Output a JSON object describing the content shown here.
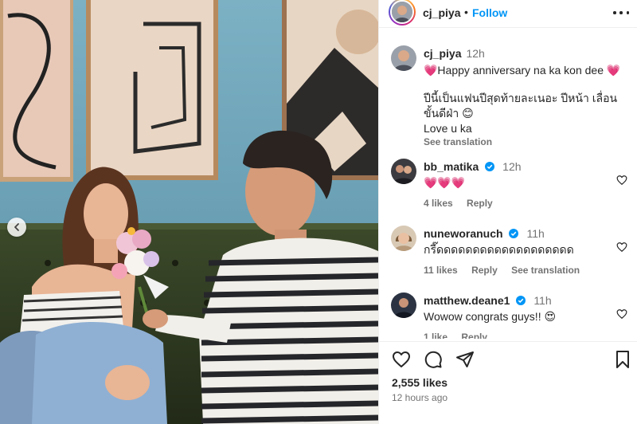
{
  "post": {
    "username": "cj_piya",
    "separator": "•",
    "follow_label": "Follow",
    "likes": "2,555 likes",
    "time_ago": "12 hours ago"
  },
  "caption": {
    "username": "cj_piya",
    "time": "12h",
    "line1": "💗Happy anniversary na ka kon dee 💗",
    "line2": "ปีนี้เป็นแฟนปีสุดท้ายละเนอะ ปีหน้า เลื่อนขั้นดีฝ่า 😊",
    "line3": "Love u ka",
    "see_translation": "See translation"
  },
  "comments": [
    {
      "username": "bb_matika",
      "verified": true,
      "time": "12h",
      "text": "💗💗💗",
      "likes": "4 likes",
      "reply": "Reply",
      "see_translation": ""
    },
    {
      "username": "nuneworanuch",
      "verified": true,
      "time": "11h",
      "text": "กรี๊ดดดดดดดดดดดดดดดดดดด",
      "likes": "11 likes",
      "reply": "Reply",
      "see_translation": "See translation"
    },
    {
      "username": "matthew.deane1",
      "verified": true,
      "time": "11h",
      "text": "Wowow congrats guys!! 😍",
      "likes": "1 like",
      "reply": "Reply",
      "see_translation": ""
    }
  ],
  "icons": {
    "header_more": "more-horizontal-icon",
    "carousel": "chevron-left-icon",
    "like": "heart-icon",
    "comment": "comment-icon",
    "share": "share-icon",
    "save": "bookmark-icon",
    "verified": "verified-badge-icon"
  },
  "colors": {
    "link_blue": "#0095f6",
    "verified_blue": "#0095f6",
    "text": "#262626",
    "muted": "#737373",
    "wall_blue": "#6a9fb5"
  }
}
